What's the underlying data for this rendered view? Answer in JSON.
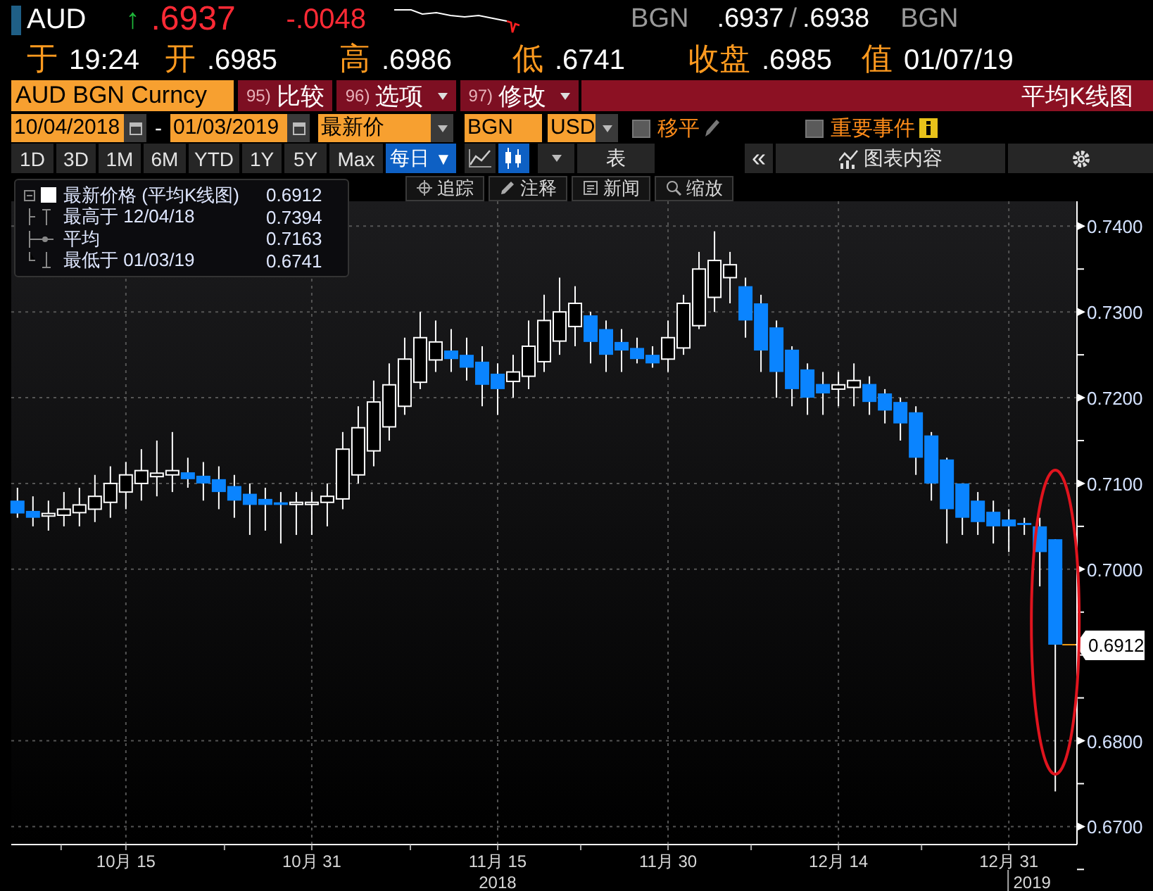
{
  "quote_header": {
    "symbol": "AUD",
    "arrow": "↑",
    "last": ".6937",
    "change": ".0048",
    "change_sign": "-",
    "source": "BGN",
    "bid": ".6937",
    "separator": "/",
    "ask": ".6938",
    "source_2": "BGN"
  },
  "quote_line": [
    {
      "label": "于",
      "value": "19:24"
    },
    {
      "label": "开",
      "value": ".6985"
    },
    {
      "label": "高",
      "value": ".6986"
    },
    {
      "label": "低",
      "value": ".6741"
    },
    {
      "label": "收盘",
      "value": ".6985"
    },
    {
      "label": "值",
      "value": "01/07/19"
    }
  ],
  "command_bar": {
    "ticker": "AUD BGN Curncy",
    "buttons": [
      {
        "number": "95)",
        "label": "比较",
        "dropdown": false
      },
      {
        "number": "96)",
        "label": "选项",
        "dropdown": true
      },
      {
        "number": "97)",
        "label": "修改",
        "dropdown": true
      }
    ],
    "title": "平均K线图"
  },
  "settings": {
    "start_date": "10/04/2018",
    "dash": "-",
    "end_date": "01/03/2019",
    "price_field": "最新价",
    "source": "BGN",
    "currency": "USD",
    "toggles": [
      {
        "kind": "edit",
        "label": "移平",
        "checked": false
      },
      {
        "kind": "info",
        "label": "重要事件",
        "checked": false
      }
    ]
  },
  "toolbar": {
    "periods": [
      {
        "label": "1D",
        "selected": false
      },
      {
        "label": "3D",
        "selected": false
      },
      {
        "label": "1M",
        "selected": false
      },
      {
        "label": "6M",
        "selected": false
      },
      {
        "label": "YTD",
        "selected": false
      },
      {
        "label": "1Y",
        "selected": false
      },
      {
        "label": "5Y",
        "selected": false
      },
      {
        "label": "Max",
        "selected": false
      }
    ],
    "frequency": "每日",
    "frequency_arrow": "▼",
    "chart_types": [
      {
        "kind": "line",
        "selected": false
      },
      {
        "kind": "candle",
        "selected": true
      }
    ],
    "table": "表",
    "collapse": "«",
    "content": "图表内容"
  },
  "tools": [
    {
      "kind": "track",
      "label": "追踪"
    },
    {
      "kind": "annotate",
      "label": "注释"
    },
    {
      "kind": "news",
      "label": "新闻"
    },
    {
      "kind": "zoom",
      "label": "缩放"
    }
  ],
  "legend": [
    {
      "kind": "last",
      "label": "最新价格 (平均K线图)",
      "value": "0.6912"
    },
    {
      "kind": "high",
      "label": "最高于 12/04/18",
      "value": "0.7394"
    },
    {
      "kind": "average",
      "label": "平均",
      "value": "0.7163"
    },
    {
      "kind": "low",
      "label": "最低于 01/03/19",
      "value": "0.6741"
    }
  ],
  "chart": {
    "chart_data": {
      "type": "candlestick",
      "categories": [
        null,
        null,
        null,
        null,
        null,
        null,
        null,
        "10月 15",
        null,
        null,
        null,
        null,
        null,
        null,
        null,
        null,
        null,
        null,
        null,
        "10月 31",
        null,
        null,
        null,
        null,
        null,
        null,
        null,
        null,
        null,
        null,
        null,
        "11月 15",
        null,
        null,
        null,
        null,
        null,
        null,
        null,
        null,
        null,
        null,
        "11月 30",
        null,
        null,
        null,
        null,
        null,
        null,
        null,
        null,
        null,
        null,
        "12月 14",
        null,
        null,
        null,
        null,
        null,
        null,
        null,
        null,
        null,
        null,
        "12月 31",
        null,
        null,
        null
      ],
      "ohlc": [
        [
          0.708,
          0.7095,
          0.706,
          0.7065
        ],
        [
          0.7068,
          0.7085,
          0.705,
          0.706
        ],
        [
          0.7062,
          0.708,
          0.7045,
          0.7065
        ],
        [
          0.7063,
          0.709,
          0.705,
          0.707
        ],
        [
          0.7066,
          0.7095,
          0.705,
          0.7075
        ],
        [
          0.707,
          0.711,
          0.7055,
          0.7085
        ],
        [
          0.7078,
          0.712,
          0.706,
          0.71
        ],
        [
          0.709,
          0.7125,
          0.707,
          0.711
        ],
        [
          0.71,
          0.714,
          0.708,
          0.7115
        ],
        [
          0.7108,
          0.715,
          0.7085,
          0.7112
        ],
        [
          0.711,
          0.716,
          0.709,
          0.7115
        ],
        [
          0.7113,
          0.713,
          0.7095,
          0.7105
        ],
        [
          0.7109,
          0.7125,
          0.708,
          0.71
        ],
        [
          0.7105,
          0.712,
          0.707,
          0.709
        ],
        [
          0.7097,
          0.711,
          0.706,
          0.708
        ],
        [
          0.7088,
          0.71,
          0.704,
          0.7075
        ],
        [
          0.7082,
          0.7095,
          0.7045,
          0.7075
        ],
        [
          0.7078,
          0.709,
          0.703,
          0.7075
        ],
        [
          0.7077,
          0.709,
          0.704,
          0.7078
        ],
        [
          0.7077,
          0.709,
          0.704,
          0.7078
        ],
        [
          0.7078,
          0.71,
          0.705,
          0.7085
        ],
        [
          0.7082,
          0.716,
          0.707,
          0.714
        ],
        [
          0.711,
          0.719,
          0.71,
          0.7165
        ],
        [
          0.7138,
          0.722,
          0.712,
          0.7195
        ],
        [
          0.7166,
          0.724,
          0.715,
          0.7215
        ],
        [
          0.719,
          0.727,
          0.718,
          0.7245
        ],
        [
          0.7218,
          0.73,
          0.721,
          0.727
        ],
        [
          0.7244,
          0.729,
          0.723,
          0.7265
        ],
        [
          0.7255,
          0.728,
          0.723,
          0.7245
        ],
        [
          0.725,
          0.727,
          0.722,
          0.7235
        ],
        [
          0.7242,
          0.726,
          0.719,
          0.7215
        ],
        [
          0.7228,
          0.724,
          0.718,
          0.721
        ],
        [
          0.7219,
          0.725,
          0.72,
          0.723
        ],
        [
          0.7225,
          0.729,
          0.721,
          0.726
        ],
        [
          0.7242,
          0.732,
          0.723,
          0.729
        ],
        [
          0.7266,
          0.734,
          0.725,
          0.73
        ],
        [
          0.7283,
          0.733,
          0.726,
          0.731
        ],
        [
          0.7296,
          0.73,
          0.724,
          0.7265
        ],
        [
          0.728,
          0.729,
          0.723,
          0.725
        ],
        [
          0.7265,
          0.728,
          0.723,
          0.7255
        ],
        [
          0.7258,
          0.727,
          0.724,
          0.7245
        ],
        [
          0.725,
          0.726,
          0.7235,
          0.724
        ],
        [
          0.7245,
          0.729,
          0.723,
          0.727
        ],
        [
          0.7258,
          0.732,
          0.725,
          0.731
        ],
        [
          0.7284,
          0.737,
          0.728,
          0.735
        ],
        [
          0.7317,
          0.7394,
          0.73,
          0.736
        ],
        [
          0.734,
          0.737,
          0.731,
          0.7355
        ],
        [
          0.733,
          0.734,
          0.727,
          0.729
        ],
        [
          0.731,
          0.732,
          0.723,
          0.7255
        ],
        [
          0.7282,
          0.729,
          0.72,
          0.723
        ],
        [
          0.7256,
          0.726,
          0.719,
          0.721
        ],
        [
          0.7233,
          0.724,
          0.718,
          0.72
        ],
        [
          0.7216,
          0.723,
          0.718,
          0.7205
        ],
        [
          0.721,
          0.723,
          0.719,
          0.7215
        ],
        [
          0.7212,
          0.724,
          0.719,
          0.722
        ],
        [
          0.7216,
          0.7225,
          0.718,
          0.7195
        ],
        [
          0.7205,
          0.721,
          0.717,
          0.7185
        ],
        [
          0.7195,
          0.72,
          0.715,
          0.717
        ],
        [
          0.7183,
          0.719,
          0.711,
          0.713
        ],
        [
          0.7156,
          0.716,
          0.708,
          0.71
        ],
        [
          0.7128,
          0.713,
          0.703,
          0.707
        ],
        [
          0.71,
          0.71,
          0.704,
          0.706
        ],
        [
          0.708,
          0.709,
          0.704,
          0.7055
        ],
        [
          0.7067,
          0.708,
          0.703,
          0.705
        ],
        [
          0.7058,
          0.707,
          0.702,
          0.705
        ],
        [
          0.7054,
          0.706,
          0.704,
          0.7053
        ],
        [
          0.705,
          0.706,
          0.698,
          0.702
        ],
        [
          0.7035,
          0.7035,
          0.6741,
          0.6912
        ]
      ],
      "ylim": [
        0.6679,
        0.7429
      ],
      "yticks": [
        {
          "value": 0.74,
          "label": "0.7400"
        },
        {
          "value": 0.73,
          "label": "0.7300"
        },
        {
          "value": 0.72,
          "label": "0.7200"
        },
        {
          "value": 0.71,
          "label": "0.7100"
        },
        {
          "value": 0.7,
          "label": "0.7000"
        },
        {
          "value": 0.68,
          "label": "0.6800"
        },
        {
          "value": 0.67,
          "label": "0.6700"
        }
      ],
      "grid": true
    },
    "last_price_label": "0.6912",
    "years": [
      "2018",
      "2019"
    ]
  }
}
